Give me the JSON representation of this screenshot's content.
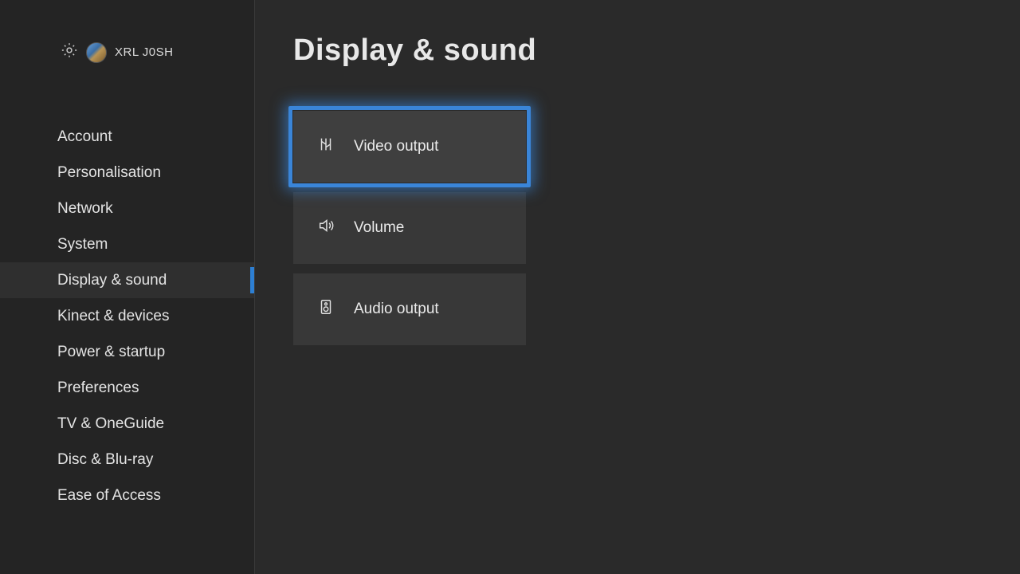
{
  "profile": {
    "name": "XRL J0SH"
  },
  "sidebar": {
    "activeIndex": 4,
    "items": [
      {
        "label": "Account"
      },
      {
        "label": "Personalisation"
      },
      {
        "label": "Network"
      },
      {
        "label": "System"
      },
      {
        "label": "Display & sound"
      },
      {
        "label": "Kinect & devices"
      },
      {
        "label": "Power & startup"
      },
      {
        "label": "Preferences"
      },
      {
        "label": "TV & OneGuide"
      },
      {
        "label": "Disc & Blu-ray"
      },
      {
        "label": "Ease of Access"
      }
    ]
  },
  "page": {
    "title": "Display & sound",
    "focusedTile": 0,
    "tiles": [
      {
        "icon": "video-output-icon",
        "label": "Video output"
      },
      {
        "icon": "volume-icon",
        "label": "Volume"
      },
      {
        "icon": "audio-output-icon",
        "label": "Audio output"
      }
    ]
  }
}
